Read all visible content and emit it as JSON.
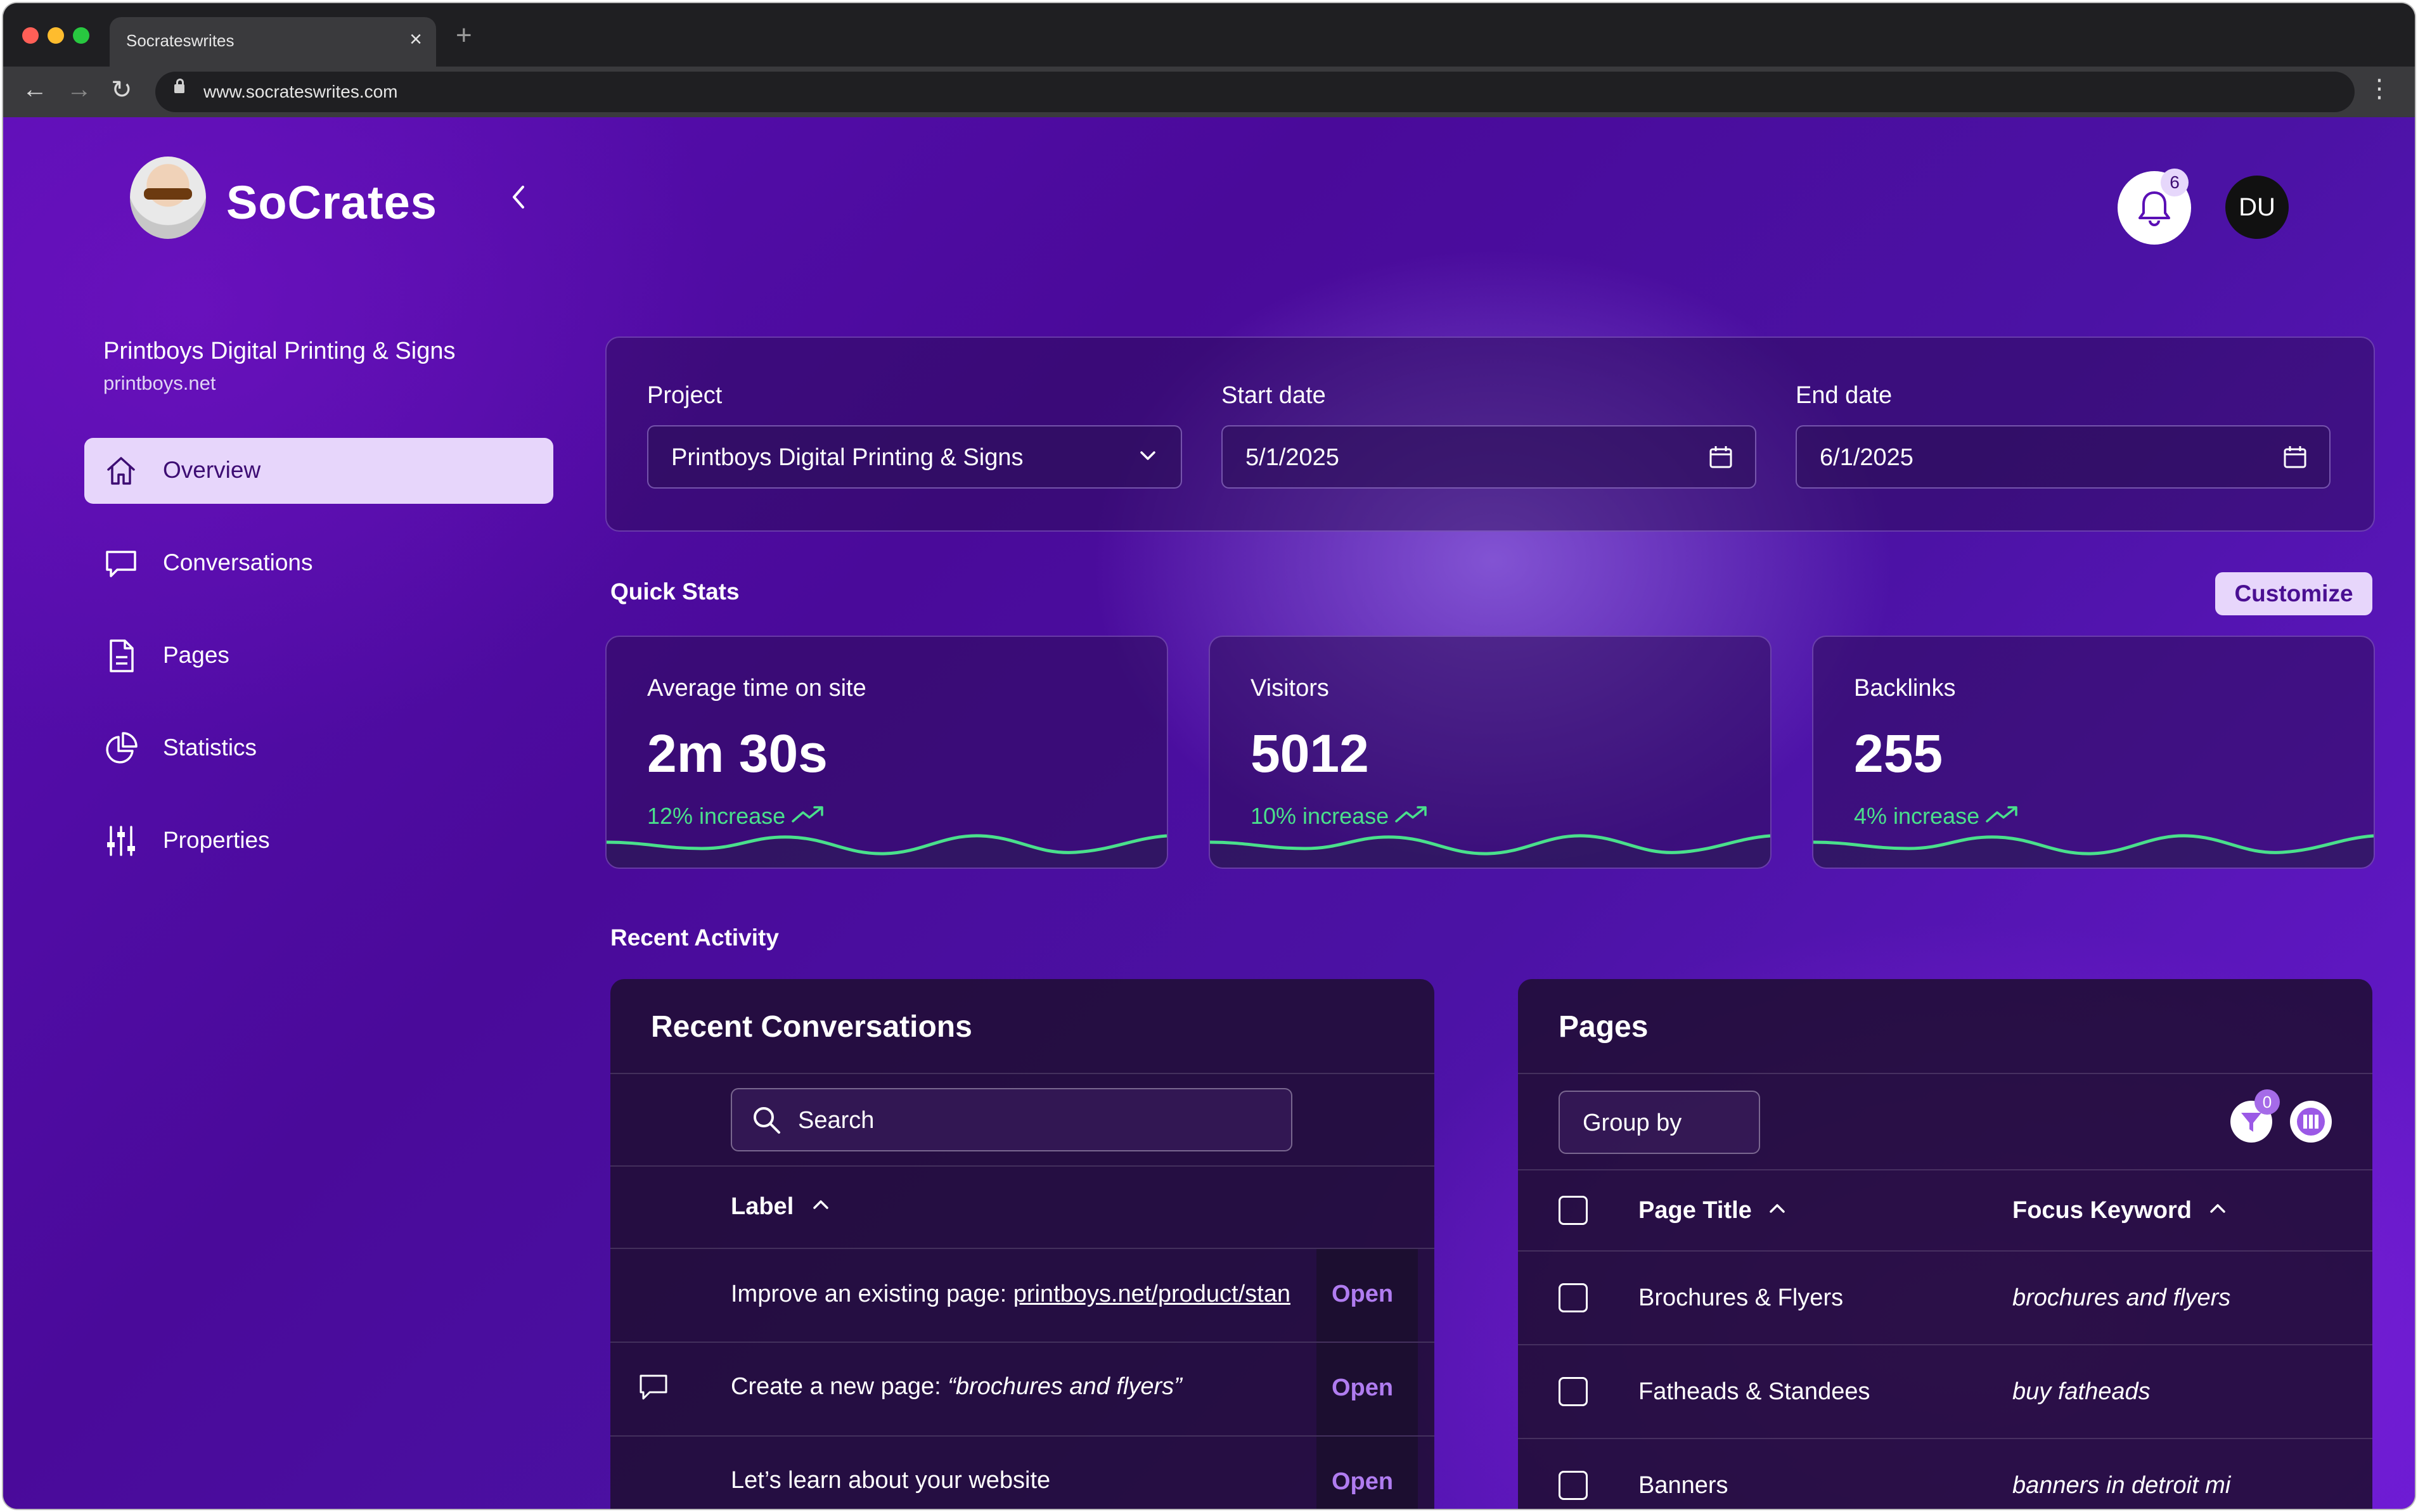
{
  "browser": {
    "tab_title": "Socrateswrites",
    "tab_close": "×",
    "new_tab": "+",
    "url": "www.socrateswrites.com"
  },
  "app": {
    "brand": "SoCrates",
    "collapse_icon": "chevron-left-icon"
  },
  "sidebar": {
    "project_name": "Printboys Digital Printing & Signs",
    "project_domain": "printboys.net",
    "items": [
      {
        "label": "Overview",
        "icon": "home-icon",
        "active": true
      },
      {
        "label": "Conversations",
        "icon": "chat-bubble-icon",
        "active": false
      },
      {
        "label": "Pages",
        "icon": "document-icon",
        "active": false
      },
      {
        "label": "Statistics",
        "icon": "pie-chart-icon",
        "active": false
      },
      {
        "label": "Properties",
        "icon": "sliders-icon",
        "active": false
      }
    ]
  },
  "header": {
    "notification_count": "6",
    "user_initials": "DU"
  },
  "filters": {
    "project_label": "Project",
    "project_value": "Printboys Digital Printing & Signs",
    "start_label": "Start date",
    "start_value": "5/1/2025",
    "end_label": "End date",
    "end_value": "6/1/2025"
  },
  "quick_stats": {
    "title": "Quick Stats",
    "customize": "Customize",
    "cards": [
      {
        "label": "Average time on site",
        "value": "2m 30s",
        "change": "12% increase"
      },
      {
        "label": "Visitors",
        "value": "5012",
        "change": "10% increase"
      },
      {
        "label": "Backlinks",
        "value": "255",
        "change": "4% increase"
      }
    ]
  },
  "recent_activity": {
    "title": "Recent Activity",
    "conversations": {
      "title": "Recent Conversations",
      "search_placeholder": "Search",
      "column_label": "Label",
      "rows": [
        {
          "prefix": "Improve an existing page: ",
          "link": "printboys.net/product/stan",
          "action": "Open"
        },
        {
          "prefix": "Create a new page: ",
          "italic": "“brochures and flyers”",
          "action": "Open"
        },
        {
          "prefix": "Let’s learn about your website",
          "action": "Open"
        }
      ]
    },
    "pages": {
      "title": "Pages",
      "group_by": "Group by",
      "filter_count": "0",
      "col_title": "Page Title",
      "col_keyword": "Focus Keyword",
      "rows": [
        {
          "title": "Brochures & Flyers",
          "keyword": "brochures and flyers"
        },
        {
          "title": "Fatheads & Standees",
          "keyword": "buy fatheads"
        },
        {
          "title": "Banners",
          "keyword": "banners in detroit mi"
        }
      ]
    }
  },
  "colors": {
    "accent": "#e7d6fb",
    "positive": "#4ae08c",
    "link": "#b07cf0",
    "bg_purple": "#5a0fb5"
  }
}
